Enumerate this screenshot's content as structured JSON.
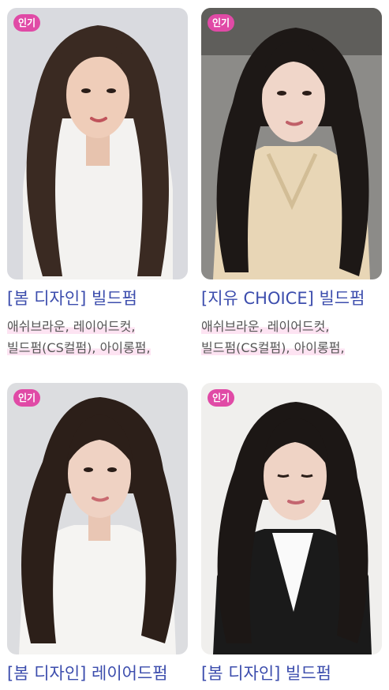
{
  "cards": [
    {
      "badge": "인기",
      "title": "[봄 디자인] 빌드펌",
      "tags_line1": "애쉬브라운, 레이어드컷,",
      "tags_line2": "빌드펌(CS컬펌), 아이롱펌,",
      "photo": "long dark brown layered hair, white top",
      "bg": "#d9dadf",
      "hair": "#3a2a22",
      "top": "#f3f2f0"
    },
    {
      "badge": "인기",
      "title": "[지유 CHOICE] 빌드펌",
      "tags_line1": "애쉬브라운, 레이어드컷,",
      "tags_line2": "빌드펌(CS컬펌), 아이롱펌,",
      "photo": "long black wavy hair, beige cable-knit sweater",
      "bg": "#8c8b88",
      "hair": "#1d1816",
      "top": "#e8d6b6"
    },
    {
      "badge": "인기",
      "title": "[봄 디자인] 레이어드펌",
      "photo": "long dark layered hair, white t-shirt",
      "bg": "#dcdde0",
      "hair": "#2c1f19",
      "top": "#f5f4f2"
    },
    {
      "badge": "인기",
      "title": "[봄 디자인] 빌드펌",
      "photo": "long black layered hair, black vest over white shirt",
      "bg": "#f0efed",
      "hair": "#1c1715",
      "top": "#1a1a1a"
    }
  ]
}
